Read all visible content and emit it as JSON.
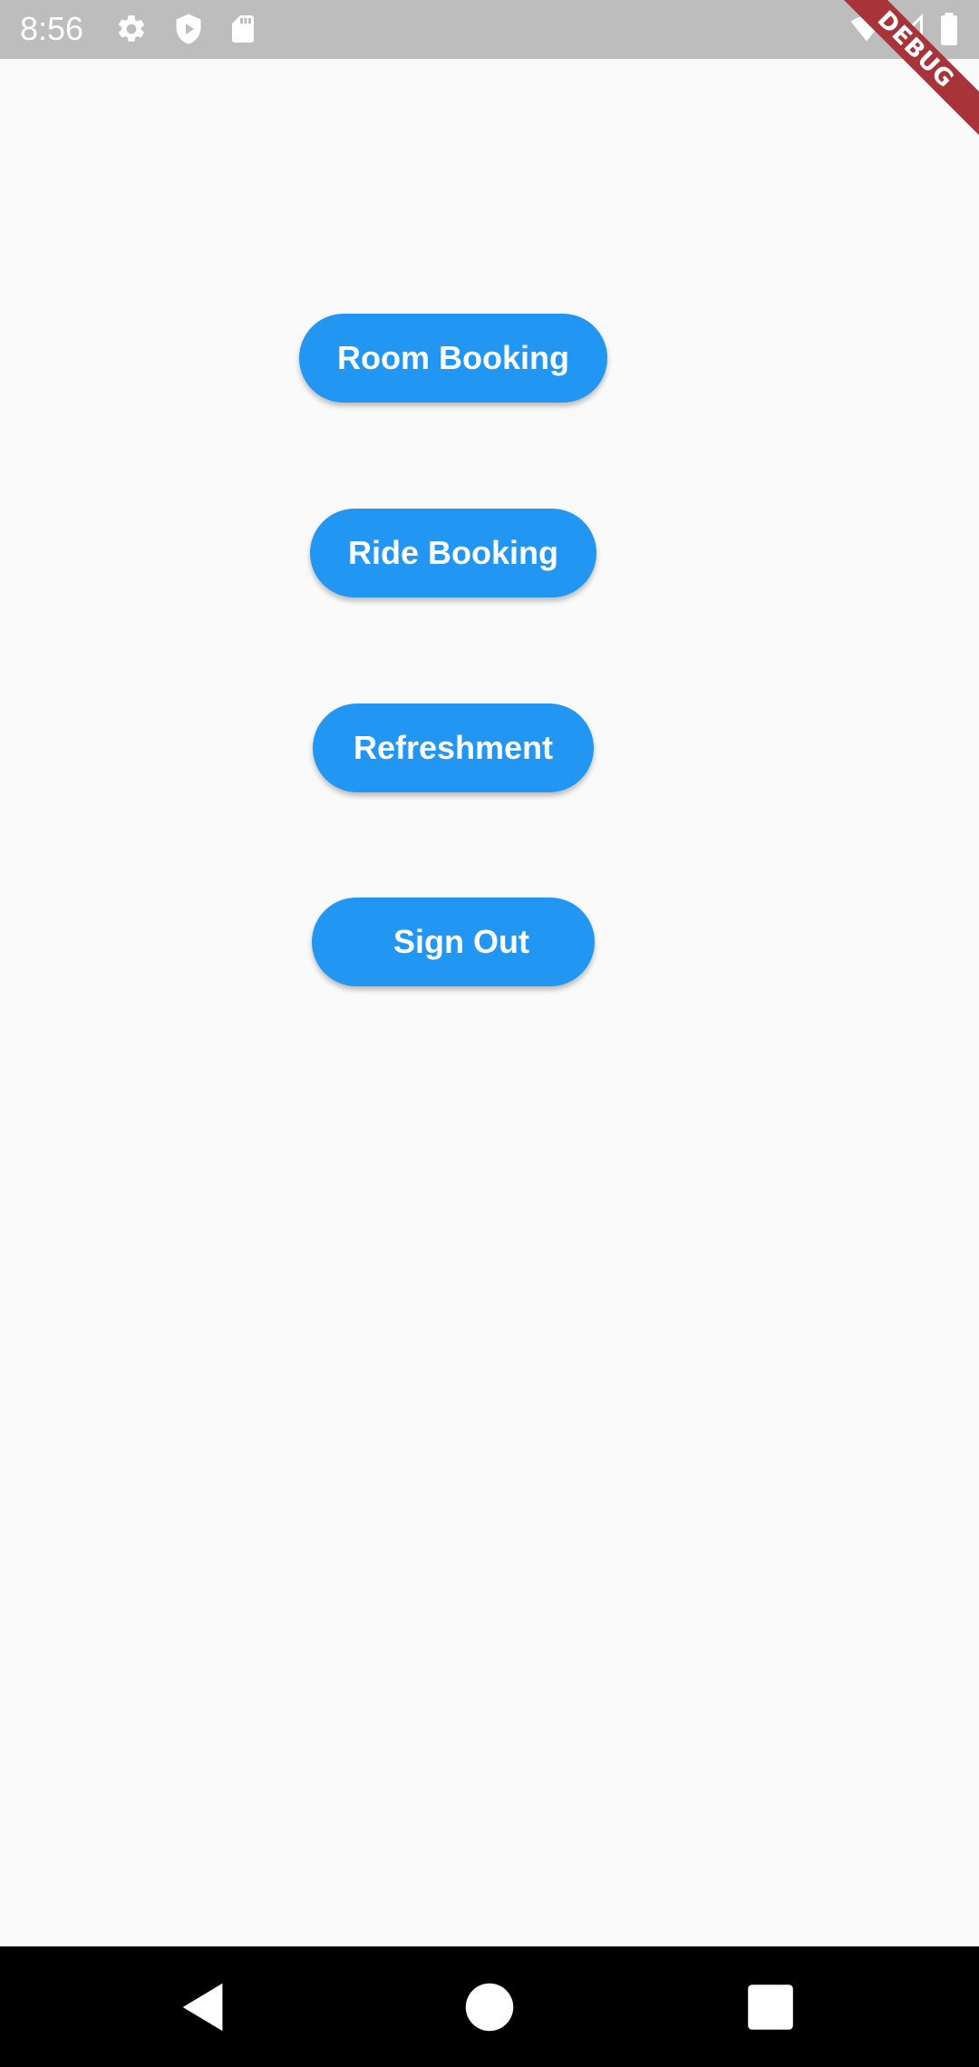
{
  "status_bar": {
    "time": "8:56",
    "left_icons": [
      "gear-icon",
      "shield-play-icon",
      "sd-card-icon"
    ],
    "right_icons": [
      "wifi-icon",
      "cell-signal-icon",
      "battery-icon"
    ]
  },
  "debug_banner": {
    "label": "DEBUG"
  },
  "menu": {
    "room_booking": "Room Booking",
    "ride_booking": "Ride Booking",
    "refreshment": "Refreshment",
    "sign_out": "Sign Out"
  },
  "colors": {
    "accent": "#2196f3",
    "background": "#fafafa",
    "status_bar": "#bdbdbd",
    "debug_banner": "#a8343a"
  },
  "nav_bar": {
    "icons": [
      "back-icon",
      "home-icon",
      "recents-icon"
    ]
  }
}
